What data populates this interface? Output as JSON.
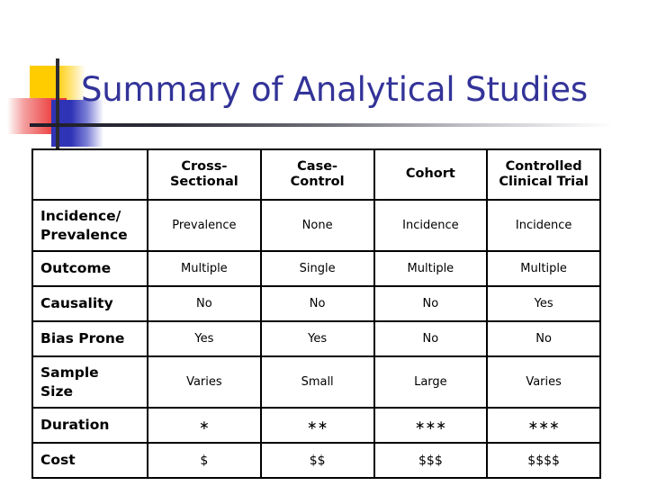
{
  "slide": {
    "title": "Summary of Analytical Studies",
    "title_color": "#333399",
    "decoration": {
      "yellow_color": "#FFCC00",
      "red_color": "#EE4B4B",
      "blue_color": "#2F33B5",
      "line_color": "#2B2B33"
    }
  },
  "table": {
    "corner_label": "",
    "columns": [
      "Cross-Sectional",
      "Case-Control",
      "Cohort",
      "Controlled Clinical Trial"
    ],
    "columns_lines": [
      [
        "Cross-",
        "Sectional"
      ],
      [
        "Case-",
        "Control"
      ],
      [
        "Cohort"
      ],
      [
        "Controlled",
        "Clinical Trial"
      ]
    ],
    "rows": [
      {
        "label": "Incidence/ Prevalence",
        "label_lines": [
          "Incidence/",
          "Prevalence"
        ],
        "values": [
          "Prevalence",
          "None",
          "Incidence",
          "Incidence"
        ]
      },
      {
        "label": "Outcome",
        "label_lines": [
          "Outcome"
        ],
        "values": [
          "Multiple",
          "Single",
          "Multiple",
          "Multiple"
        ]
      },
      {
        "label": "Causality",
        "label_lines": [
          "Causality"
        ],
        "values": [
          "No",
          "No",
          "No",
          "Yes"
        ]
      },
      {
        "label": "Bias Prone",
        "label_lines": [
          "Bias Prone"
        ],
        "values": [
          "Yes",
          "Yes",
          "No",
          "No"
        ]
      },
      {
        "label": "Sample Size",
        "label_lines": [
          "Sample",
          "Size"
        ],
        "values": [
          "Varies",
          "Small",
          "Large",
          "Varies"
        ]
      },
      {
        "label": "Duration",
        "label_lines": [
          "Duration"
        ],
        "values": [
          "∗",
          "∗∗",
          "∗∗∗",
          "∗∗∗"
        ]
      },
      {
        "label": "Cost",
        "label_lines": [
          "Cost"
        ],
        "values": [
          "$",
          "$$",
          "$$$",
          "$$$$"
        ]
      }
    ]
  }
}
